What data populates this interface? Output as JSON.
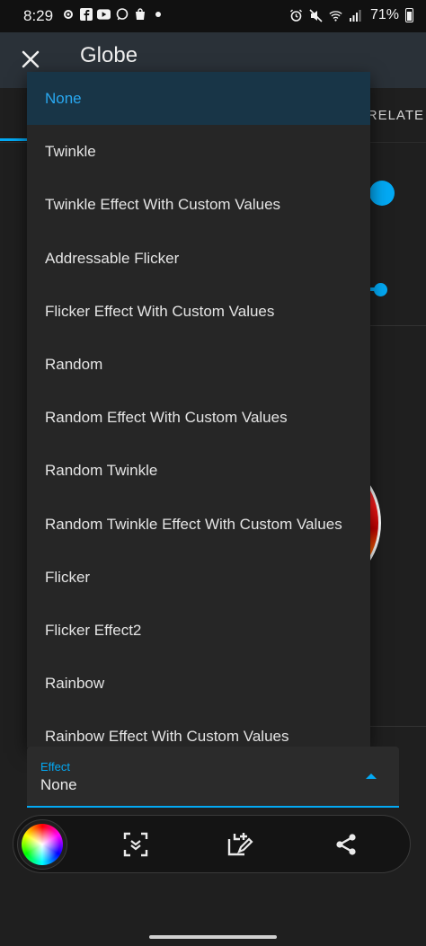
{
  "status_bar": {
    "time": "8:29",
    "battery_text": "71%",
    "left_icons": [
      "settings-icon",
      "facebook-icon",
      "youtube-icon",
      "messenger-icon",
      "shopping-bag-icon",
      "dot-icon"
    ],
    "right_icons": [
      "alarm-icon",
      "mute-icon",
      "wifi-icon",
      "signal-icon",
      "battery-icon"
    ]
  },
  "app_bar": {
    "title": "Globe",
    "close_icon": "close-icon"
  },
  "background": {
    "tab_label": "RELATE"
  },
  "dropdown": {
    "selected": "None",
    "items": [
      "None",
      "Twinkle",
      "Twinkle Effect With Custom Values",
      "Addressable Flicker",
      "Flicker Effect With Custom Values",
      "Random",
      "Random Effect With Custom Values",
      "Random Twinkle",
      "Random Twinkle Effect With Custom Values",
      "Flicker",
      "Flicker Effect2",
      "Rainbow",
      "Rainbow Effect With Custom Values"
    ]
  },
  "effect_field": {
    "label": "Effect",
    "value": "None"
  },
  "toolbar": {
    "buttons": [
      "color-wheel-icon",
      "scan-icon",
      "edit-crop-icon",
      "share-icon"
    ]
  },
  "colors": {
    "accent": "#03a9f4",
    "selected_bg": "#183547",
    "menu_bg": "#262626",
    "page_bg": "#1f1f1f"
  }
}
